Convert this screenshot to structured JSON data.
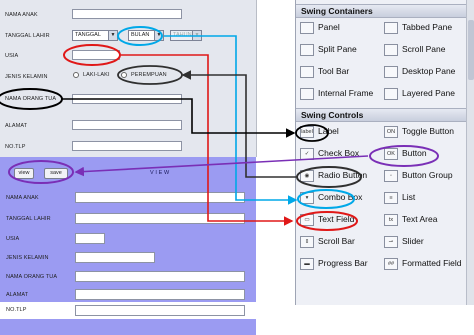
{
  "form": {
    "labels": {
      "nama_anak": "NAMA ANAK",
      "tanggal_lahir": "TANGGAL LAHIR",
      "usia": "USIA",
      "jenis_kelamin": "JENIS KELAMIN",
      "nama_orang_tua": "NAMA ORANG TUA",
      "alamat": "ALAMAT",
      "no_tlp": "NO.TLP"
    },
    "combos": {
      "tanggal": "TANGGAL",
      "bulan": "BULAN",
      "tahun": "TAHUN"
    },
    "radios": {
      "laki_laki": "LAKI-LAKI",
      "perempuan": "PEREMPUAN"
    },
    "buttons": {
      "view": "view",
      "save": "save"
    },
    "view_label": "V I E W",
    "colors": {
      "top_bg": "#e4e7ee",
      "view_bg": "#9b9bf2"
    }
  },
  "palette": {
    "containers_title": "Swing Containers",
    "containers": [
      {
        "label": "Panel",
        "icon": "panel-icon"
      },
      {
        "label": "Tabbed Pane",
        "icon": "tabbed-pane-icon"
      },
      {
        "label": "Split Pane",
        "icon": "split-pane-icon"
      },
      {
        "label": "Scroll Pane",
        "icon": "scroll-pane-icon"
      },
      {
        "label": "Tool Bar",
        "icon": "tool-bar-icon"
      },
      {
        "label": "Desktop Pane",
        "icon": "desktop-pane-icon"
      },
      {
        "label": "Internal Frame",
        "icon": "internal-frame-icon"
      },
      {
        "label": "Layered Pane",
        "icon": "layered-pane-icon"
      }
    ],
    "controls_title": "Swing Controls",
    "controls": [
      {
        "label": "Label",
        "icon": "label-icon",
        "icon_text": "label"
      },
      {
        "label": "Toggle Button",
        "icon": "toggle-button-icon",
        "icon_text": "ON"
      },
      {
        "label": "Check Box",
        "icon": "check-box-icon",
        "icon_text": "✓"
      },
      {
        "label": "Button",
        "icon": "button-icon",
        "icon_text": "OK"
      },
      {
        "label": "Radio Button",
        "icon": "radio-button-icon",
        "icon_text": "◉"
      },
      {
        "label": "Button Group",
        "icon": "button-group-icon",
        "icon_text": "◦"
      },
      {
        "label": "Combo Box",
        "icon": "combo-box-icon",
        "icon_text": "▾"
      },
      {
        "label": "List",
        "icon": "list-icon",
        "icon_text": "≡"
      },
      {
        "label": "Text Field",
        "icon": "text-field-icon",
        "icon_text": "▭"
      },
      {
        "label": "Text Area",
        "icon": "text-area-icon",
        "icon_text": "tx"
      },
      {
        "label": "Scroll Bar",
        "icon": "scroll-bar-icon",
        "icon_text": "⇕"
      },
      {
        "label": "Slider",
        "icon": "slider-icon",
        "icon_text": "⊸"
      },
      {
        "label": "Progress Bar",
        "icon": "progress-bar-icon",
        "icon_text": "▬"
      },
      {
        "label": "Formatted Field",
        "icon": "formatted-field-icon",
        "icon_text": "##"
      }
    ]
  },
  "annotation_colors": {
    "label": "#000000",
    "button": "#7a2fb6",
    "radio": "#303030",
    "combo": "#00a8e8",
    "text_field": "#e01818"
  }
}
